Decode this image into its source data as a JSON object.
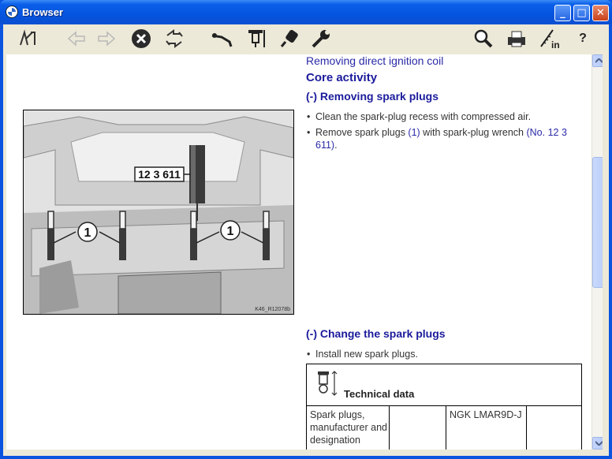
{
  "window": {
    "title": "Browser",
    "controls": {
      "minimize": "_",
      "maximize": "□",
      "close": "✕"
    }
  },
  "toolbar": {
    "icons": [
      "info-browse-icon",
      "back-arrow-icon",
      "forward-arrow-icon",
      "stop-icon",
      "refresh-icon",
      "tool-wrench-icon",
      "inspection-icon",
      "lubricant-icon",
      "spanner-icon",
      "search-icon",
      "print-icon",
      "ruler-in-icon",
      "help-icon"
    ],
    "help_label": "?",
    "in_label": "in"
  },
  "document": {
    "breadcrumb": "Removing direct ignition coil",
    "heading": "Core activity",
    "section1": {
      "title": "(-) Removing spark plugs",
      "bullet1": "Clean the spark-plug recess with compressed air.",
      "bullet2_pre": "Remove spark plugs ",
      "bullet2_ref": "(1)",
      "bullet2_mid": " with spark-plug wrench ",
      "bullet2_tool": "(No. 12 3 611)",
      "bullet2_end": "."
    },
    "section2": {
      "title": "(-) Change the spark plugs",
      "bullet1": "Install new spark plugs."
    },
    "tech_table": {
      "title": "Technical data",
      "row_label": "Spark plugs, manufacturer and designation",
      "row_value": "NGK LMAR9D-J"
    },
    "figure": {
      "tool_label": "12 3 611",
      "callout1": "1",
      "callout2": "1",
      "image_id": "K46_R12078b"
    }
  },
  "colors": {
    "title_blue": "#0a54e0",
    "link_blue": "#2a2aa8",
    "heading_blue": "#1b1b9c",
    "chrome": "#ece9d8"
  }
}
